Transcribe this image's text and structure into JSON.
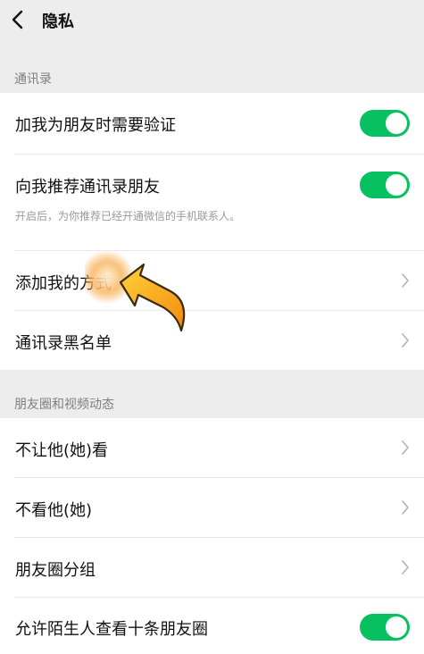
{
  "header": {
    "title": "隐私",
    "back_icon": "chevron-left-icon"
  },
  "sections": {
    "contacts": {
      "label": "通讯录",
      "items": [
        {
          "label": "加我为朋友时需要验证",
          "control": "toggle",
          "on": true
        },
        {
          "label": "向我推荐通讯录朋友",
          "sublabel": "开启后，为你推荐已经开通微信的手机联系人。",
          "control": "toggle",
          "on": true
        },
        {
          "label": "添加我的方式",
          "control": "chevron"
        },
        {
          "label": "通讯录黑名单",
          "control": "chevron"
        }
      ]
    },
    "moments": {
      "label": "朋友圈和视频动态",
      "items": [
        {
          "label": "不让他(她)看",
          "control": "chevron"
        },
        {
          "label": "不看他(她)",
          "control": "chevron"
        },
        {
          "label": "朋友圈分组",
          "control": "chevron"
        },
        {
          "label": "允许陌生人查看十条朋友圈",
          "control": "toggle",
          "on": true
        }
      ]
    }
  },
  "colors": {
    "toggle_on": "#07c160",
    "background": "#ededed",
    "panel": "#ffffff",
    "tap_highlight": "#f7a23a"
  },
  "icons": {
    "chevron": "chevron-right-icon",
    "pointer": "tap-pointer-icon"
  }
}
